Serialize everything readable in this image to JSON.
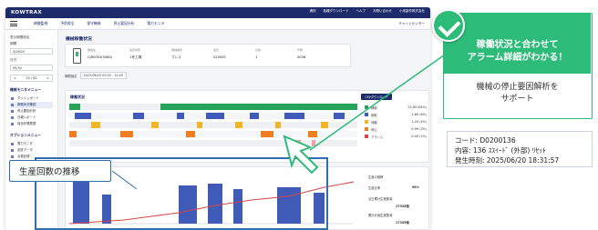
{
  "app": {
    "logo": "KOWTRAX",
    "topnav": [
      "通知",
      "各種ダウンロード",
      "ヘルプ",
      "お問い合わせ",
      "小池製作株式会社"
    ],
    "menus": [
      "稼働監視",
      "予防保全",
      "保守機械",
      "停止要因分析",
      "電力モニタ"
    ],
    "chat": "チャットセンター"
  },
  "sidebar": {
    "date_label": "表示期間設定",
    "month_label": "期間",
    "month": "5/26/20",
    "day_label": "日付",
    "day": "05/30",
    "pager": {
      "prev": "<",
      "page": "15 / 82",
      "next": ">"
    },
    "section": "機械モニタメニュー",
    "items": [
      "ダッシュボード",
      "稼働状況確認",
      "停止要因分析",
      "日報レポート",
      "保全作業履歴"
    ],
    "section2": "オプションメニュー",
    "items2": [
      "電力モニタ",
      "品質データ",
      "点検記録"
    ]
  },
  "main": {
    "title": "機械稼働状況",
    "mach_heads": [
      "機械名",
      "設置場所",
      "機械種別",
      "型式",
      "台数",
      "号機"
    ],
    "mach_vals": [
      "CJR0003(5080)",
      "1号工場",
      "プレス",
      "S2000S",
      "1",
      "0006"
    ],
    "date_label": "期間指定",
    "date_val": "2025/06/20 00:00 - 24:00",
    "chart_title": "稼働状況",
    "csv": "CSVダウンロード",
    "legend": [
      {
        "label": "稼働",
        "color": "#27a35a",
        "val": "23.9H (84%)"
      },
      {
        "label": "段取",
        "color": "#3f5bb7",
        "val": "1.6H (6%)"
      },
      {
        "label": "待機",
        "color": "#f0b429",
        "val": "1.2H (4%)"
      },
      {
        "label": "停止",
        "color": "#ef7d22",
        "val": "0.9H (3%)"
      },
      {
        "label": "アラーム",
        "color": "#d64545",
        "val": "0.4H (1%)"
      }
    ],
    "tooltip": [
      "コード: D0200136",
      "内容: 136 ｽｽｲｰﾄﾞ (外部) ﾘｾｯﾄ",
      "発生時刻: 2025/06/20 18:31:57"
    ],
    "trend_right": [
      {
        "label": "生産の推移",
        "val": ""
      },
      {
        "label": "生産比率",
        "val": "98%"
      },
      {
        "label": "当日累計生産数量",
        "val": "17335個"
      },
      {
        "label": "累計計画生産数量",
        "val": "17335個"
      }
    ]
  },
  "badge": "生産回数の推移",
  "callout": {
    "headline1": "稼働状況と合わせて",
    "headline2": "アラーム詳細がわかる！",
    "sub1": "機械の停止要因解析を",
    "sub2": "サポート"
  },
  "alarm": {
    "code": "コード: D0200136",
    "content": "内容: 136 ｽｽｲｰﾄﾞ (外部) ﾘｾｯﾄ",
    "time": "発生時刻: 2025/06/20 18:31:57"
  }
}
